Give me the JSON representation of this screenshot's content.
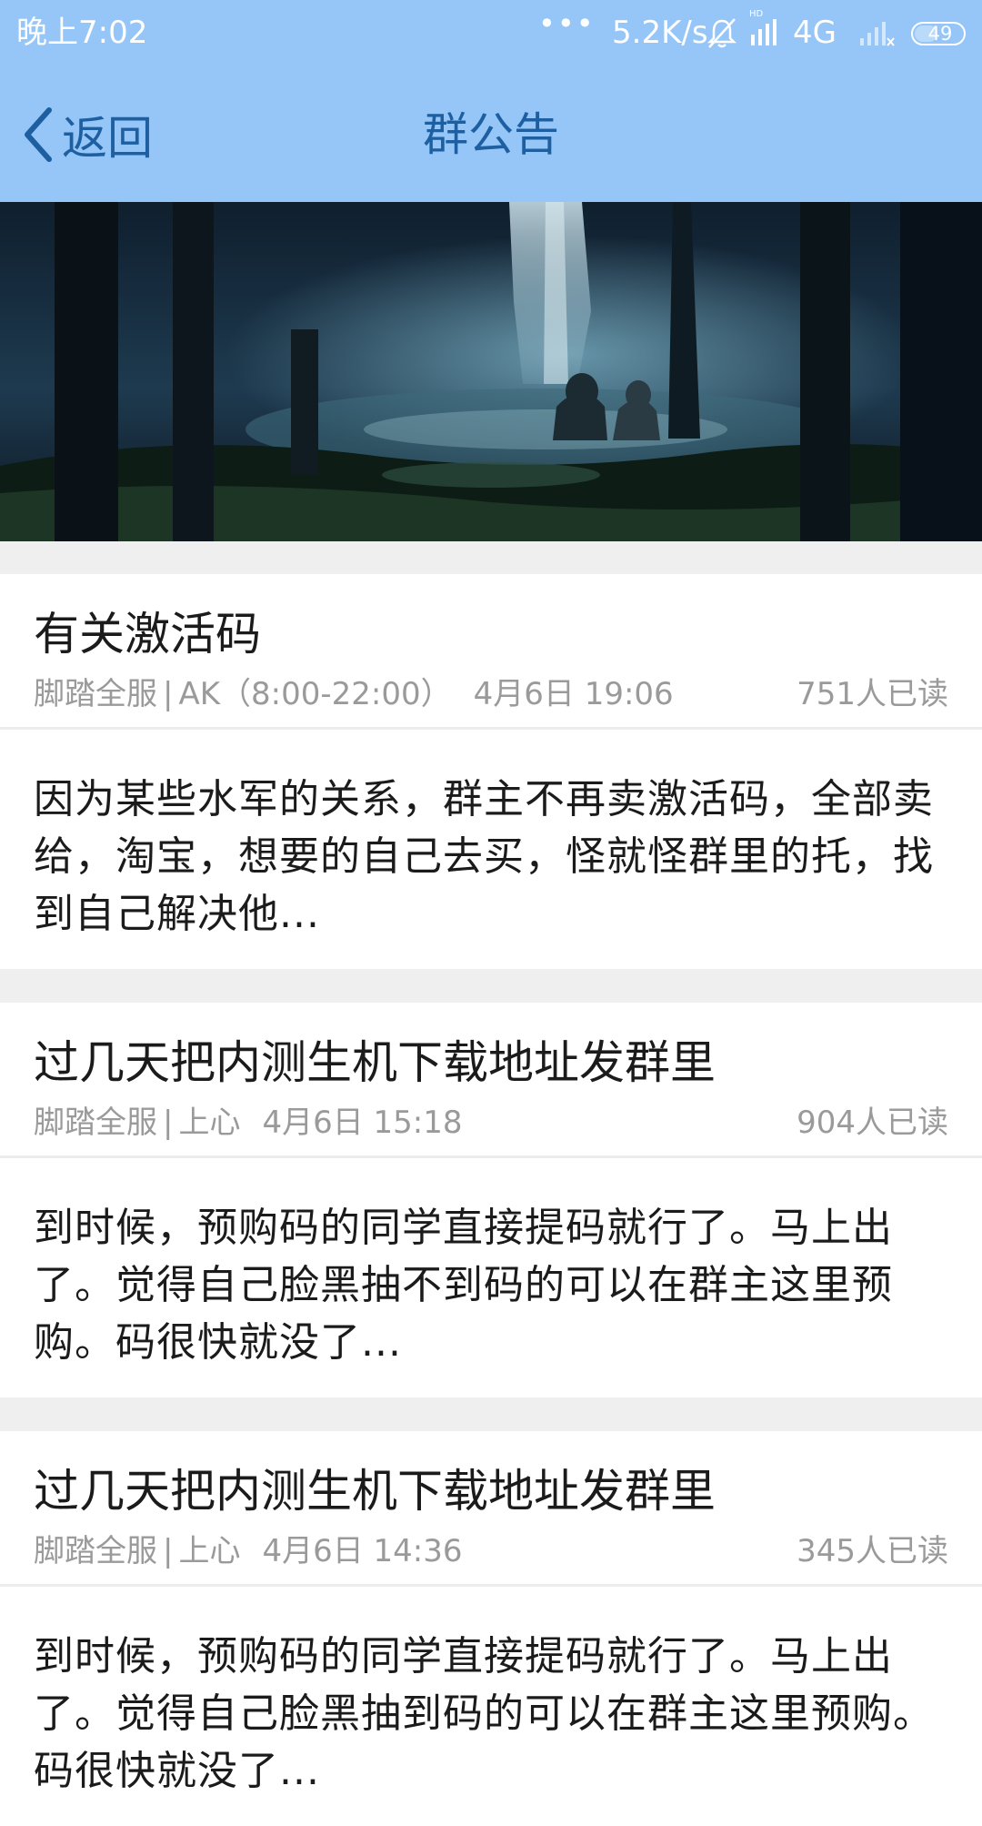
{
  "status_bar": {
    "time": "晚上7:02",
    "dots": "•••",
    "net_speed": "5.2K/s",
    "network_type": "4G",
    "battery_level": 49,
    "battery_text": "49",
    "icons": [
      "mute-bell-icon",
      "hd-signal-icon",
      "secondary-signal-icon",
      "battery-icon"
    ]
  },
  "nav": {
    "back_label": "返回",
    "title": "群公告"
  },
  "banner": {
    "description_icon": "forest-waterfall-illustration"
  },
  "colors": {
    "header_background": "#95c6f7",
    "nav_text": "#1d5fa0",
    "page_background": "#efefef",
    "meta_text": "#9a9a9a"
  },
  "notices": [
    {
      "title": "有关激活码",
      "group": "脚踏全服",
      "author": "AK（8:00-22:00）",
      "date": "4月6日 19:06",
      "reads": "751人已读",
      "body": "因为某些水军的关系，群主不再卖激活码，全部卖给，淘宝，想要的自己去买，怪就怪群里的托，找到自己解决他..."
    },
    {
      "title": "过几天把内测生机下载地址发群里",
      "group": "脚踏全服",
      "author": "上心",
      "date": "4月6日 15:18",
      "reads": "904人已读",
      "body": "到时候，预购码的同学直接提码就行了。马上出了。觉得自己脸黑抽不到码的可以在群主这里预购。码很快就没了..."
    },
    {
      "title": "过几天把内测生机下载地址发群里",
      "group": "脚踏全服",
      "author": "上心",
      "date": "4月6日 14:36",
      "reads": "345人已读",
      "body": "到时候，预购码的同学直接提码就行了。马上出了。觉得自己脸黑抽到码的可以在群主这里预购。码很快就没了..."
    }
  ]
}
